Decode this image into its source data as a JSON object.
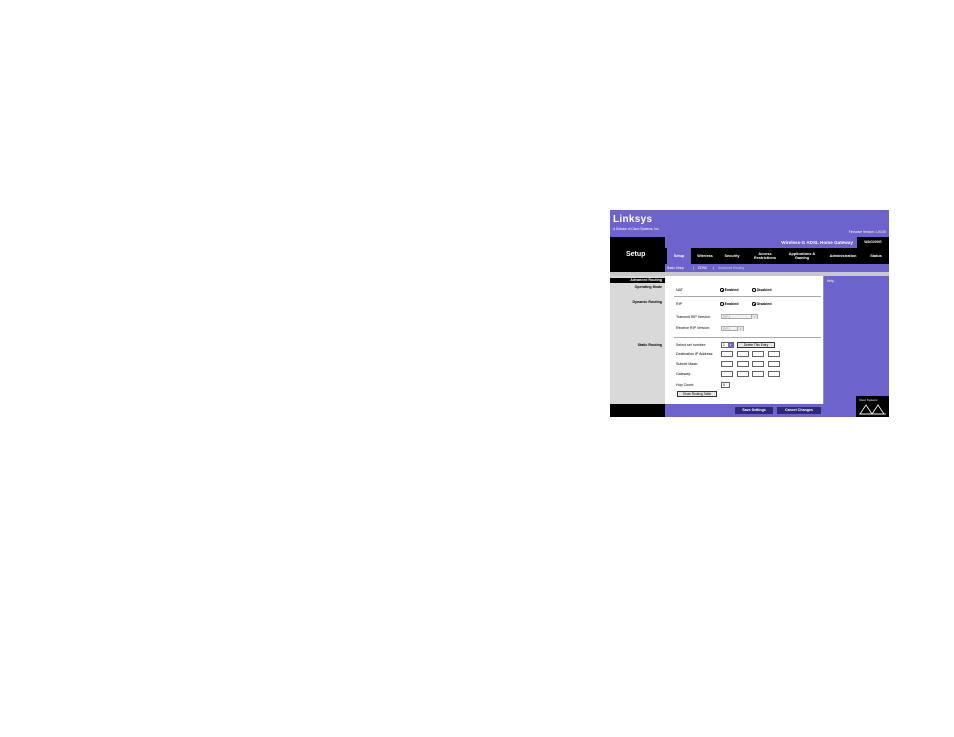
{
  "header": {
    "logo": "Linksys",
    "logo_sub": "A Division of Cisco Systems, Inc.",
    "firmware": "Firmware Version: 1.00.00",
    "product_name": "Wireless-G ADSL Home Gateway",
    "model": "WAG200G",
    "section_title": "Setup"
  },
  "tabs": [
    {
      "label": "Setup"
    },
    {
      "label": "Wireless"
    },
    {
      "label": "Security"
    },
    {
      "label": "Access Restrictions"
    },
    {
      "label": "Applications & Gaming"
    },
    {
      "label": "Administration"
    },
    {
      "label": "Status"
    }
  ],
  "subtabs": [
    {
      "label": "Basic Setup"
    },
    {
      "label": "DDNS"
    },
    {
      "label": "Advanced Routing"
    }
  ],
  "help_label": "Help...",
  "left_labels": {
    "advanced_routing": "Advanced Routing",
    "operating_mode": "Operating Mode",
    "dynamic_routing": "Dynamic Routing",
    "static_routing": "Static Routing"
  },
  "operating_mode": {
    "label": "NAT",
    "enabled": "Enabled",
    "disabled": "Disabled",
    "selected": "Enabled"
  },
  "dynamic_routing": {
    "rip_label": "RIP",
    "enabled": "Enabled",
    "disabled": "Disabled",
    "selected": "Disabled",
    "transmit_label": "Transmit RIP Version:",
    "transmit_value": "RIP1",
    "receive_label": "Receive RIP Version:",
    "receive_value": "RIP1"
  },
  "static_routing": {
    "set_number_label": "Select set number:",
    "set_number_value": "1",
    "delete_button": "Delete This Entry",
    "dest_ip_label": "Destination IP Address:",
    "subnet_label": "Subnet Mask:",
    "gateway_label": "Gateway:",
    "hop_label": "Hop Count:",
    "hop_value": "0",
    "show_table_button": "Show Routing Table"
  },
  "footer": {
    "save_button": "Save Settings",
    "cancel_button": "Cancel Changes",
    "cisco_text": "Cisco Systems"
  }
}
